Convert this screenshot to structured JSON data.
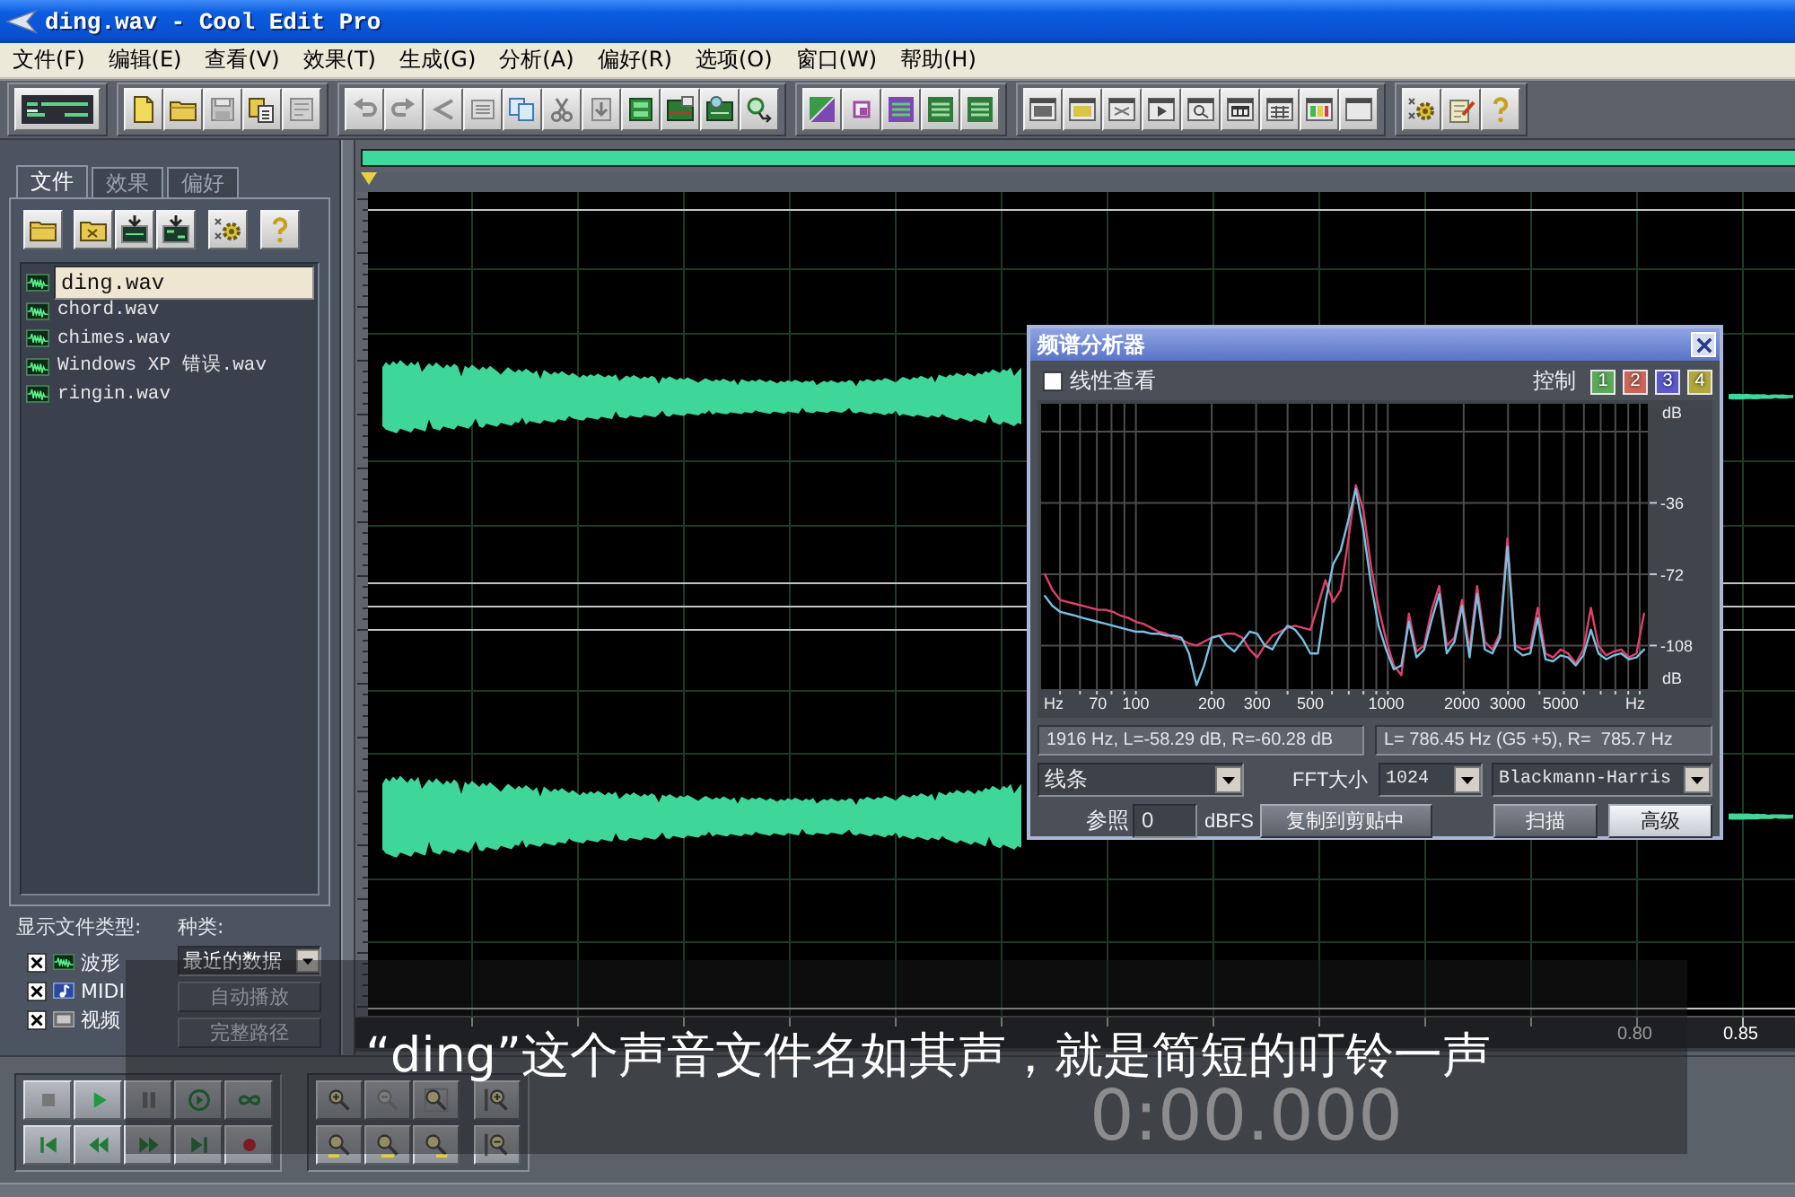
{
  "window": {
    "title": "ding.wav - Cool Edit Pro"
  },
  "menu": [
    "文件(F)",
    "编辑(E)",
    "查看(V)",
    "效果(T)",
    "生成(G)",
    "分析(A)",
    "偏好(R)",
    "选项(O)",
    "窗口(W)",
    "帮助(H)"
  ],
  "file_panel": {
    "tabs": [
      {
        "label": "文件",
        "selected": true
      },
      {
        "label": "效果",
        "selected": false
      },
      {
        "label": "偏好",
        "selected": false
      }
    ],
    "files": [
      {
        "name": "ding.wav",
        "selected": true
      },
      {
        "name": "chord.wav",
        "selected": false
      },
      {
        "name": "chimes.wav",
        "selected": false
      },
      {
        "name": "Windows XP 错误.wav",
        "selected": false
      },
      {
        "name": "ringin.wav",
        "selected": false
      }
    ],
    "filter_label": "显示文件类型:",
    "file_types": [
      {
        "kind": "wave",
        "label": "波形",
        "checked": true
      },
      {
        "kind": "midi",
        "label": "MIDI",
        "checked": true
      },
      {
        "kind": "video",
        "label": "视频",
        "checked": true
      }
    ],
    "sort_label": "种类:",
    "sort_select": {
      "value": "最近的数据"
    },
    "buttons": [
      {
        "label": "自动播放",
        "disabled": true
      },
      {
        "label": "完整路径",
        "disabled": true
      }
    ]
  },
  "waveform": {
    "ruler_labels": [
      "0.80",
      "0.85"
    ]
  },
  "spectrum_analyzer": {
    "title": "频谱分析器",
    "linear_view": {
      "label": "线性查看",
      "checked": false
    },
    "hold_label": "控制",
    "hold_buttons": [
      {
        "label": "1",
        "color": "#5aaa5a"
      },
      {
        "label": "2",
        "color": "#cc6658"
      },
      {
        "label": "3",
        "color": "#5a5acc"
      },
      {
        "label": "4",
        "color": "#b0a83c"
      }
    ],
    "chart_data": {
      "type": "line",
      "grid": true,
      "categories": [
        null,
        null,
        null,
        null,
        null,
        null,
        null,
        "70",
        null,
        null,
        null,
        null,
        "100",
        null,
        null,
        null,
        null,
        null,
        null,
        null,
        null,
        null,
        "200",
        null,
        null,
        null,
        null,
        null,
        "300",
        null,
        null,
        null,
        null,
        null,
        null,
        "500",
        null,
        null,
        null,
        null,
        null,
        null,
        null,
        null,
        null,
        "1000",
        null,
        null,
        null,
        null,
        null,
        null,
        null,
        null,
        null,
        "2000",
        null,
        null,
        null,
        null,
        null,
        "3000",
        null,
        null,
        null,
        null,
        null,
        null,
        "5000",
        null,
        null,
        null,
        null,
        null,
        null,
        null,
        null,
        null,
        null,
        null
      ],
      "series": [
        {
          "color": "#e0406a",
          "values": [
            -72,
            -80,
            -85,
            -86,
            -87,
            -88,
            -89,
            -90,
            -90,
            -91,
            -93,
            -94,
            -96,
            -97,
            -99,
            -101,
            -102,
            -104,
            -105,
            -107,
            -108,
            -106,
            -104,
            -103,
            -102,
            -102,
            -104,
            -110,
            -114,
            -108,
            -103,
            -101,
            -99,
            -98,
            -99,
            -100,
            -88,
            -75,
            -86,
            -80,
            -55,
            -27,
            -40,
            -68,
            -89,
            -105,
            -118,
            -123,
            -92,
            -111,
            -108,
            -90,
            -78,
            -108,
            -104,
            -85,
            -110,
            -78,
            -106,
            -110,
            -102,
            -54,
            -108,
            -110,
            -109,
            -89,
            -112,
            -114,
            -110,
            -112,
            -117,
            -110,
            -89,
            -108,
            -113,
            -111,
            -110,
            -114,
            -112,
            -92
          ]
        },
        {
          "color": "#78c0e0",
          "values": [
            -83,
            -88,
            -91,
            -92,
            -93,
            -94,
            -95,
            -96,
            -97,
            -98,
            -99,
            -100,
            -101,
            -101,
            -102,
            -102,
            -103,
            -103,
            -104,
            -112,
            -128,
            -118,
            -104,
            -103,
            -108,
            -111,
            -106,
            -101,
            -102,
            -108,
            -110,
            -103,
            -98,
            -100,
            -105,
            -112,
            -112,
            -86,
            -67,
            -60,
            -45,
            -29,
            -50,
            -77,
            -98,
            -110,
            -120,
            -118,
            -96,
            -114,
            -110,
            -95,
            -82,
            -112,
            -106,
            -88,
            -114,
            -82,
            -110,
            -112,
            -104,
            -58,
            -110,
            -113,
            -112,
            -94,
            -115,
            -116,
            -113,
            -114,
            -118,
            -113,
            -100,
            -112,
            -115,
            -113,
            -112,
            -115,
            -114,
            -110
          ]
        }
      ],
      "ylim": [
        -130,
        14
      ],
      "yticks": [
        -36,
        -72,
        -108
      ]
    },
    "y_unit_labels": [
      "dB",
      "dB"
    ],
    "x_unit_labels": [
      "Hz",
      "Hz"
    ],
    "readouts": [
      "1916 Hz, L=-58.29 dB, R=-60.28 dB",
      "L= 786.45 Hz (G5 +5), R=  785.7 Hz"
    ],
    "graph_select": {
      "value": "线条"
    },
    "fft_label": "FFT大小",
    "fft_select": {
      "value": "1024"
    },
    "window_select": {
      "value": "Blackmann-Harris"
    },
    "reference_label": "参照",
    "reference_field": {
      "value": "0"
    },
    "reference_unit": "dBFS",
    "buttons": [
      {
        "label": "复制到剪贴中",
        "active": false
      },
      {
        "label": "扫描",
        "active": false
      },
      {
        "label": "高级",
        "active": true
      }
    ]
  },
  "transport": {
    "time": "0:00.000"
  },
  "subtitle": "“ding”这个声音文件名如其声，就是简短的叮铃一声"
}
